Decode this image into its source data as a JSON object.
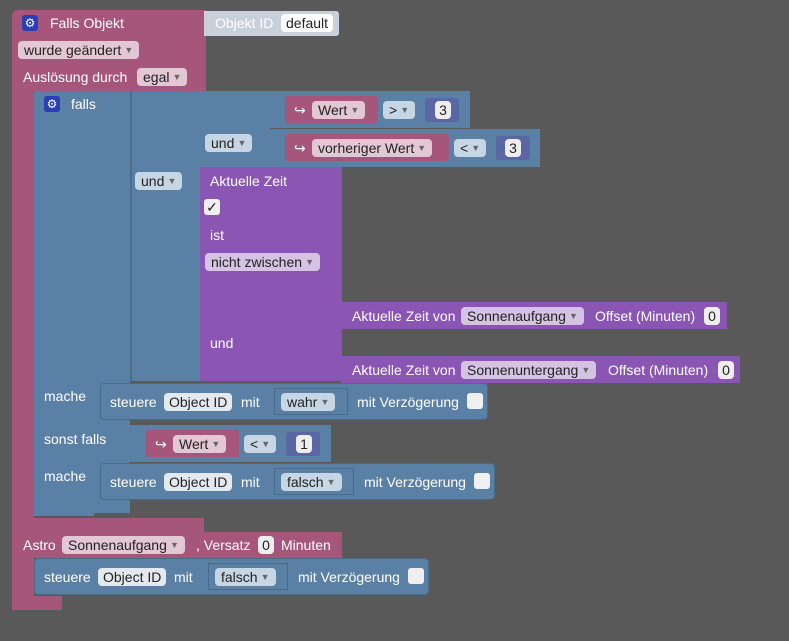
{
  "event_block": {
    "title": "Falls Objekt",
    "object_id_label": "Objekt ID",
    "object_id_value": "default",
    "trigger_mode": "wurde geändert",
    "trigger_by_label": "Auslösung durch",
    "trigger_by_value": "egal"
  },
  "if_block": {
    "if_label": "falls",
    "and_label_1": "und",
    "and_label_2": "und",
    "cond1": {
      "var": "Wert",
      "op": ">",
      "num": "3"
    },
    "cond2": {
      "var": "vorheriger Wert",
      "op": "<",
      "num": "3"
    },
    "time_block": {
      "title": "Aktuelle Zeit",
      "check": "✓",
      "is_label": "ist",
      "mode": "nicht zwischen",
      "and_label": "und",
      "from": {
        "label": "Aktuelle Zeit von",
        "event": "Sonnenaufgang",
        "offset_label": "Offset (Minuten)",
        "offset": "0"
      },
      "to": {
        "label": "Aktuelle Zeit von",
        "event": "Sonnenuntergang",
        "offset_label": "Offset (Minuten)",
        "offset": "0"
      }
    },
    "do_label_1": "mache",
    "do1": {
      "control": "steuere",
      "object": "Object ID",
      "with": "mit",
      "value": "wahr",
      "delay": "mit Verzögerung"
    },
    "elseif_label": "sonst falls",
    "cond3": {
      "var": "Wert",
      "op": "<",
      "num": "1"
    },
    "do_label_2": "mache",
    "do2": {
      "control": "steuere",
      "object": "Object ID",
      "with": "mit",
      "value": "falsch",
      "delay": "mit Verzögerung"
    }
  },
  "astro_block": {
    "label": "Astro",
    "event": "Sonnenaufgang",
    "offset_label": ", Versatz",
    "offset": "0",
    "unit": "Minuten",
    "do": {
      "control": "steuere",
      "object": "Object ID",
      "with": "mit",
      "value": "falsch",
      "delay": "mit Verzögerung"
    }
  },
  "colors": {
    "event": "#a5567a",
    "logic": "#5b80a5",
    "time": "#8a55b3",
    "math": "#5b67a5",
    "background": "#595959"
  },
  "icons": [
    "gear-icon",
    "variable-arrow-icon",
    "dropdown-arrow-icon",
    "checkbox-icon"
  ]
}
